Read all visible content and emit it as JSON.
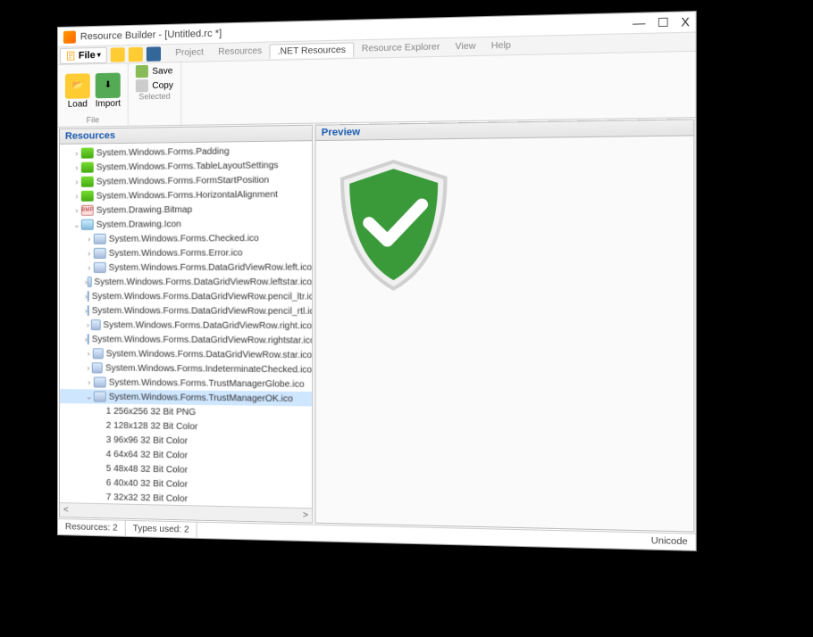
{
  "window": {
    "title": "Resource Builder - [Untitled.rc *]"
  },
  "titlebar_controls": {
    "minimize": "—",
    "maximize": "☐",
    "close": "X"
  },
  "menubar": {
    "file": "File"
  },
  "tabs": [
    {
      "label": "Project",
      "active": false
    },
    {
      "label": "Resources",
      "active": false
    },
    {
      "label": ".NET Resources",
      "active": true
    },
    {
      "label": "Resource Explorer",
      "active": false
    },
    {
      "label": "View",
      "active": false
    },
    {
      "label": "Help",
      "active": false
    }
  ],
  "ribbon": {
    "group_file": {
      "label": "File",
      "load": "Load",
      "import": "Import"
    },
    "group_selected": {
      "label": "Selected",
      "save": "Save",
      "copy": "Copy"
    }
  },
  "panels": {
    "resources": "Resources",
    "preview": "Preview"
  },
  "tree": {
    "root": [
      {
        "label": "System.Windows.Forms.Padding",
        "icon": "folder",
        "depth": 1,
        "twisty": ">"
      },
      {
        "label": "System.Windows.Forms.TableLayoutSettings",
        "icon": "folder",
        "depth": 1,
        "twisty": ">"
      },
      {
        "label": "System.Windows.Forms.FormStartPosition",
        "icon": "folder",
        "depth": 1,
        "twisty": ">"
      },
      {
        "label": "System.Windows.Forms.HorizontalAlignment",
        "icon": "folder",
        "depth": 1,
        "twisty": ">"
      },
      {
        "label": "System.Drawing.Bitmap",
        "icon": "bmp",
        "depth": 1,
        "twisty": ">"
      },
      {
        "label": "System.Drawing.Icon",
        "icon": "ico",
        "depth": 1,
        "twisty": "v"
      },
      {
        "label": "System.Windows.Forms.Checked.ico",
        "icon": "file",
        "depth": 2,
        "twisty": ">"
      },
      {
        "label": "System.Windows.Forms.Error.ico",
        "icon": "file",
        "depth": 2,
        "twisty": ">"
      },
      {
        "label": "System.Windows.Forms.DataGridViewRow.left.ico",
        "icon": "file",
        "depth": 2,
        "twisty": ">"
      },
      {
        "label": "System.Windows.Forms.DataGridViewRow.leftstar.ico",
        "icon": "file",
        "depth": 2,
        "twisty": ">"
      },
      {
        "label": "System.Windows.Forms.DataGridViewRow.pencil_ltr.ico",
        "icon": "file",
        "depth": 2,
        "twisty": ">"
      },
      {
        "label": "System.Windows.Forms.DataGridViewRow.pencil_rtl.ico",
        "icon": "file",
        "depth": 2,
        "twisty": ">"
      },
      {
        "label": "System.Windows.Forms.DataGridViewRow.right.ico",
        "icon": "file",
        "depth": 2,
        "twisty": ">"
      },
      {
        "label": "System.Windows.Forms.DataGridViewRow.rightstar.ico",
        "icon": "file",
        "depth": 2,
        "twisty": ">"
      },
      {
        "label": "System.Windows.Forms.DataGridViewRow.star.ico",
        "icon": "file",
        "depth": 2,
        "twisty": ">"
      },
      {
        "label": "System.Windows.Forms.IndeterminateChecked.ico",
        "icon": "file",
        "depth": 2,
        "twisty": ">"
      },
      {
        "label": "System.Windows.Forms.TrustManagerGlobe.ico",
        "icon": "file",
        "depth": 2,
        "twisty": ">"
      },
      {
        "label": "System.Windows.Forms.TrustManagerOK.ico",
        "icon": "file",
        "depth": 2,
        "twisty": "v",
        "selected": true
      },
      {
        "label": "1 256x256 32 Bit PNG",
        "icon": "",
        "depth": 3,
        "twisty": ""
      },
      {
        "label": "2 128x128 32 Bit Color",
        "icon": "",
        "depth": 3,
        "twisty": ""
      },
      {
        "label": "3 96x96 32 Bit Color",
        "icon": "",
        "depth": 3,
        "twisty": ""
      },
      {
        "label": "4 64x64 32 Bit Color",
        "icon": "",
        "depth": 3,
        "twisty": ""
      },
      {
        "label": "5 48x48 32 Bit Color",
        "icon": "",
        "depth": 3,
        "twisty": ""
      },
      {
        "label": "6 40x40 32 Bit Color",
        "icon": "",
        "depth": 3,
        "twisty": ""
      },
      {
        "label": "7 32x32 32 Bit Color",
        "icon": "",
        "depth": 3,
        "twisty": ""
      }
    ]
  },
  "scroll": {
    "left": "<",
    "right": ">"
  },
  "status": {
    "resources": "Resources: 2",
    "types": "Types used: 2",
    "encoding": "Unicode"
  },
  "colors": {
    "shield_fill": "#3a9a3a",
    "shield_stroke": "#d8e0d8",
    "check": "#ffffff"
  }
}
